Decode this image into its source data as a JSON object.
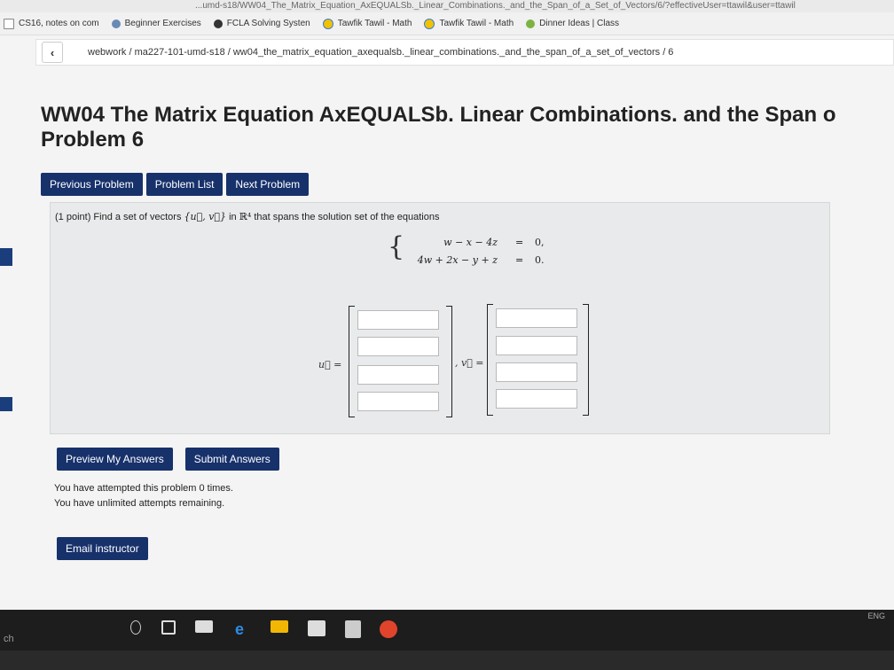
{
  "browser": {
    "url": "...umd-s18/WW04_The_Matrix_Equation_AxEQUALSb._Linear_Combinations._and_the_Span_of_a_Set_of_Vectors/6/?effectiveUser=ttawil&user=ttawil",
    "bookmarks": [
      "CS16, notes on com",
      "Beginner Exercises",
      "FCLA Solving Systen",
      "Tawfik Tawil - Math",
      "Tawfik Tawil - Math",
      "Dinner Ideas | Class"
    ]
  },
  "breadcrumb": {
    "back_icon": "chevron-left-icon",
    "path": "webwork / ma227-101-umd-s18 / ww04_the_matrix_equation_axequalsb._linear_combinations._and_the_span_of_a_set_of_vectors / 6"
  },
  "page": {
    "title_line1": "WW04 The Matrix Equation AxEQUALSb. Linear Combinations. and the Span o",
    "title_line2": "Problem 6"
  },
  "nav": {
    "previous": "Previous Problem",
    "list": "Problem List",
    "next": "Next Problem"
  },
  "problem": {
    "points": "(1 point) Find a set of vectors",
    "set": "{u⃗, v⃗}",
    "in": "in",
    "space": "ℝ⁴",
    "rest": "that spans the solution set of the equations",
    "equations": [
      {
        "lhs": "w − x − 4z",
        "rel": "=",
        "rhs": "0,"
      },
      {
        "lhs": "4w + 2x − y + z",
        "rel": "=",
        "rhs": "0."
      }
    ],
    "u_label": "u⃗ =",
    "v_label": ", v⃗ =",
    "u_fields": [
      "",
      "",
      "",
      ""
    ],
    "v_fields": [
      "",
      "",
      "",
      ""
    ]
  },
  "actions": {
    "preview": "Preview My Answers",
    "submit": "Submit Answers"
  },
  "attempts": {
    "line1": "You have attempted this problem 0 times.",
    "line2": "You have unlimited attempts remaining."
  },
  "email": "Email instructor",
  "taskbar": {
    "tray_text": "ENG",
    "left_text": "ch"
  },
  "colors": {
    "button_bg": "#17316b",
    "problem_bg": "#e9eaeb"
  }
}
